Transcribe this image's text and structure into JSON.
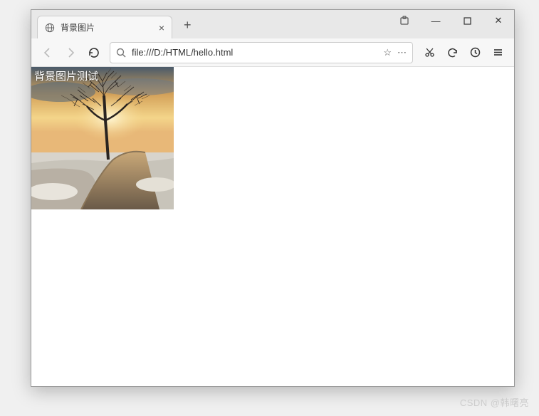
{
  "tab": {
    "title": "背景图片",
    "close_glyph": "×"
  },
  "new_tab_glyph": "+",
  "window_controls": {
    "minimize": "—",
    "maximize": "◻",
    "close": "✕"
  },
  "toolbar": {
    "url": "file:///D:/HTML/hello.html",
    "star": "☆",
    "dots": "⋯"
  },
  "page": {
    "heading": "背景图片测试"
  },
  "watermark": "CSDN @韩曙亮"
}
